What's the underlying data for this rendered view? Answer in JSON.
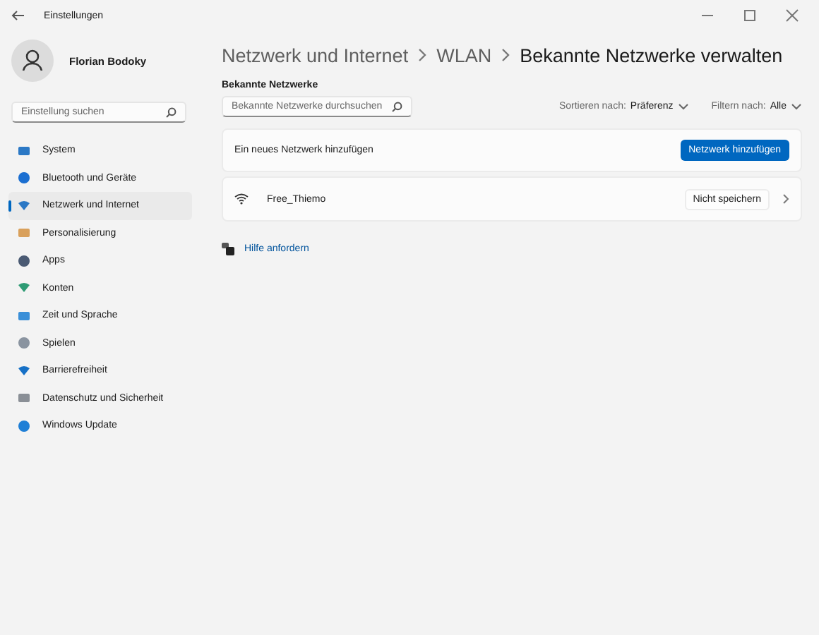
{
  "window": {
    "title": "Einstellungen"
  },
  "user": {
    "name": "Florian Bodoky"
  },
  "sidebar": {
    "search": {
      "placeholder": "Einstellung suchen"
    },
    "items": [
      {
        "label": "System",
        "selected": false
      },
      {
        "label": "Bluetooth und Geräte",
        "selected": false
      },
      {
        "label": "Netzwerk und Internet",
        "selected": true
      },
      {
        "label": "Personalisierung",
        "selected": false
      },
      {
        "label": "Apps",
        "selected": false
      },
      {
        "label": "Konten",
        "selected": false
      },
      {
        "label": "Zeit und Sprache",
        "selected": false
      },
      {
        "label": "Spielen",
        "selected": false
      },
      {
        "label": "Barrierefreiheit",
        "selected": false
      },
      {
        "label": "Datenschutz und Sicherheit",
        "selected": false
      },
      {
        "label": "Windows Update",
        "selected": false
      }
    ]
  },
  "breadcrumb": [
    {
      "label": "Netzwerk und Internet",
      "selected": false
    },
    {
      "label": "WLAN",
      "selected": false
    },
    {
      "label": "Bekannte Netzwerke verwalten",
      "selected": true
    }
  ],
  "section_title": "Bekannte Netzwerke",
  "search": {
    "placeholder": "Bekannte Netzwerke durchsuchen"
  },
  "sort": {
    "label": "Sortieren nach:",
    "value": "Präferenz"
  },
  "filter": {
    "label": "Filtern nach:",
    "value": "Alle"
  },
  "add_card": {
    "text": "Ein neues Netzwerk hinzufügen",
    "button": "Netzwerk hinzufügen"
  },
  "networks": [
    {
      "name": "Free_Thiemo",
      "button": "Nicht speichern"
    }
  ],
  "help_link": "Hilfe anfordern"
}
